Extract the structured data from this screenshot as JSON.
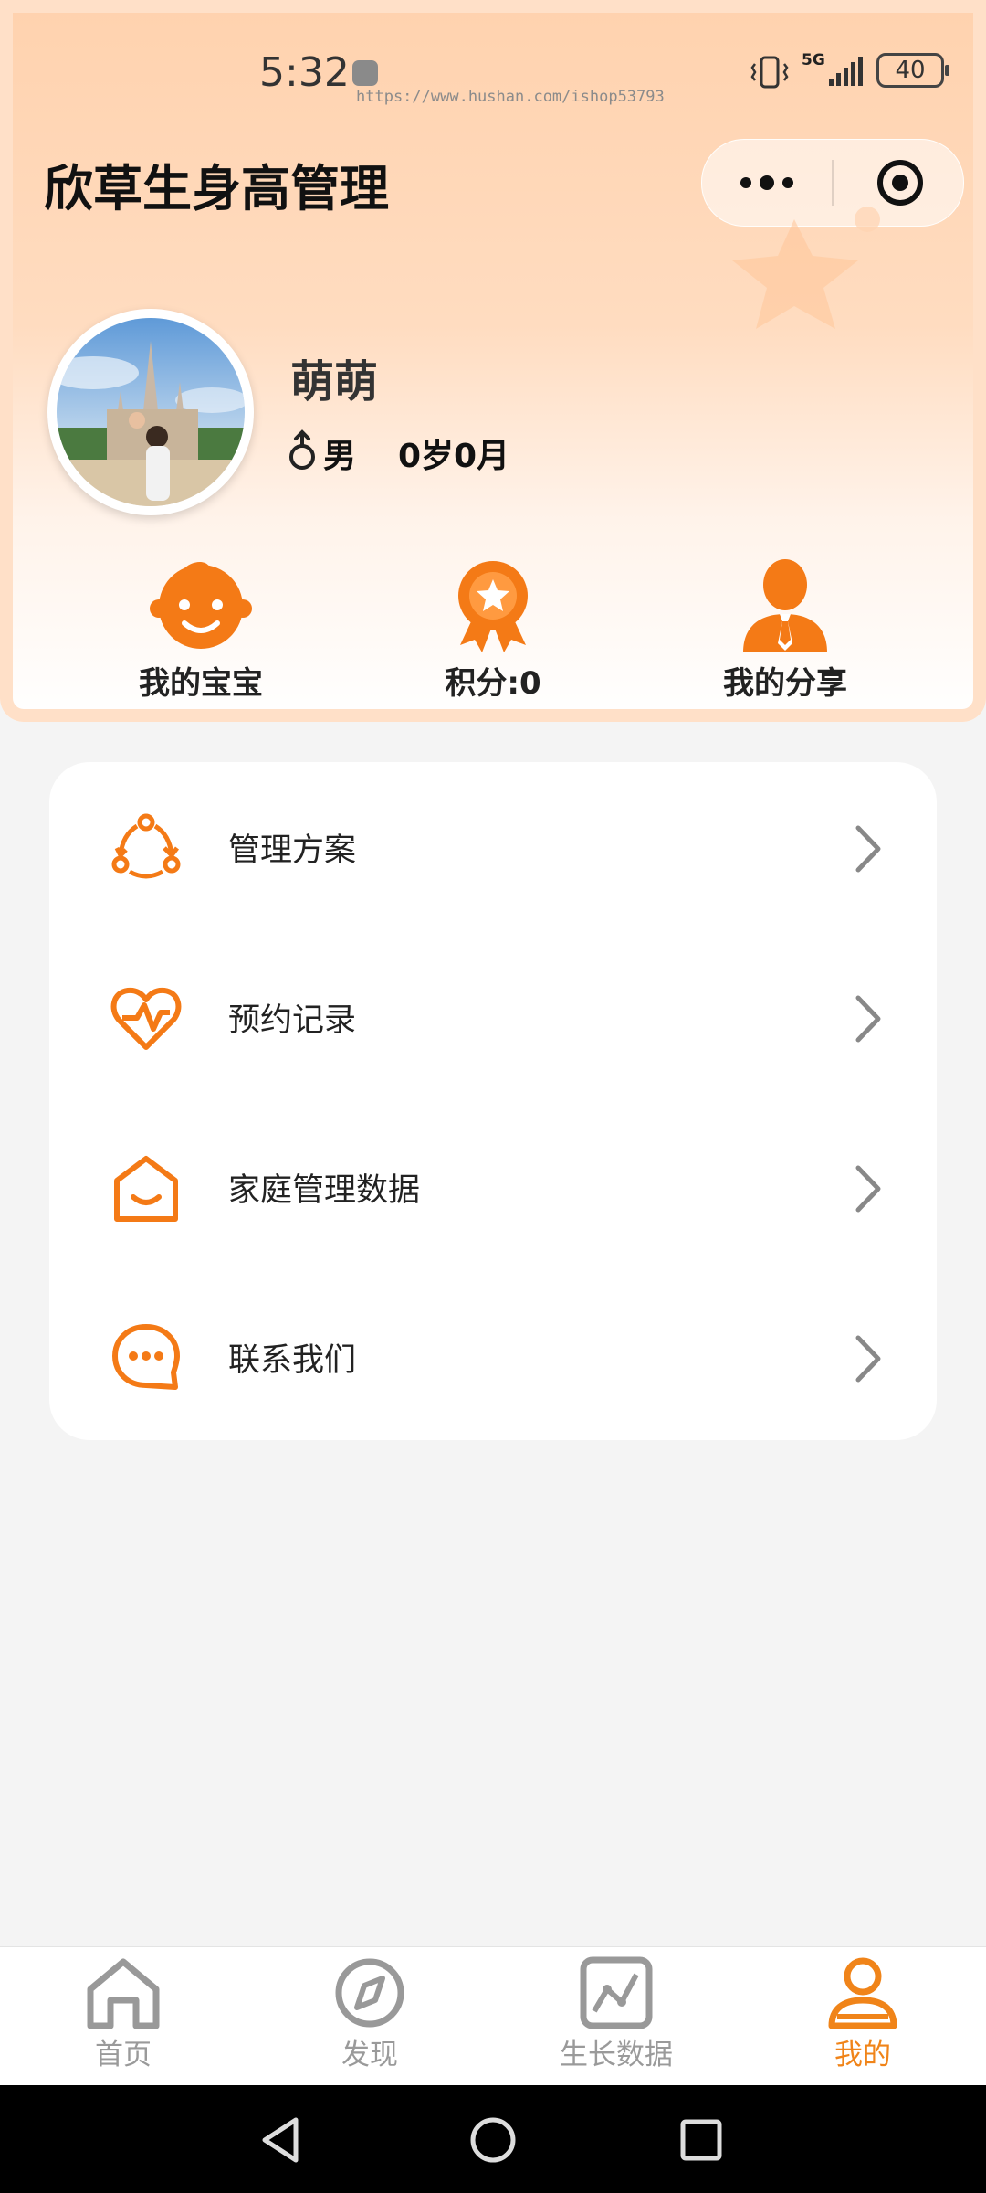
{
  "status_bar": {
    "time": "5:32",
    "watermark": "https://www.hushan.com/ishop53793",
    "network": "5G",
    "battery": "40"
  },
  "header": {
    "app_title": "欣草生身高管理"
  },
  "profile": {
    "nickname": "萌萌",
    "gender": "男",
    "age": "0岁0月"
  },
  "shortcuts": [
    {
      "label": "我的宝宝",
      "icon": "baby-face-icon"
    },
    {
      "label": "积分:0",
      "icon": "medal-star-icon"
    },
    {
      "label": "我的分享",
      "icon": "person-tie-icon"
    }
  ],
  "menu": [
    {
      "label": "管理方案",
      "icon": "cycle-arrows-icon"
    },
    {
      "label": "预约记录",
      "icon": "heart-pulse-icon"
    },
    {
      "label": "家庭管理数据",
      "icon": "home-smile-icon"
    },
    {
      "label": "联系我们",
      "icon": "chat-bubble-icon"
    }
  ],
  "tabs": [
    {
      "label": "首页",
      "icon": "home-icon",
      "active": false
    },
    {
      "label": "发现",
      "icon": "compass-icon",
      "active": false
    },
    {
      "label": "生长数据",
      "icon": "line-chart-icon",
      "active": false
    },
    {
      "label": "我的",
      "icon": "user-icon",
      "active": true
    }
  ],
  "colors": {
    "accent": "#f08419",
    "header_top": "#ffd2ae",
    "inactive_tab": "#9a9a9a"
  }
}
